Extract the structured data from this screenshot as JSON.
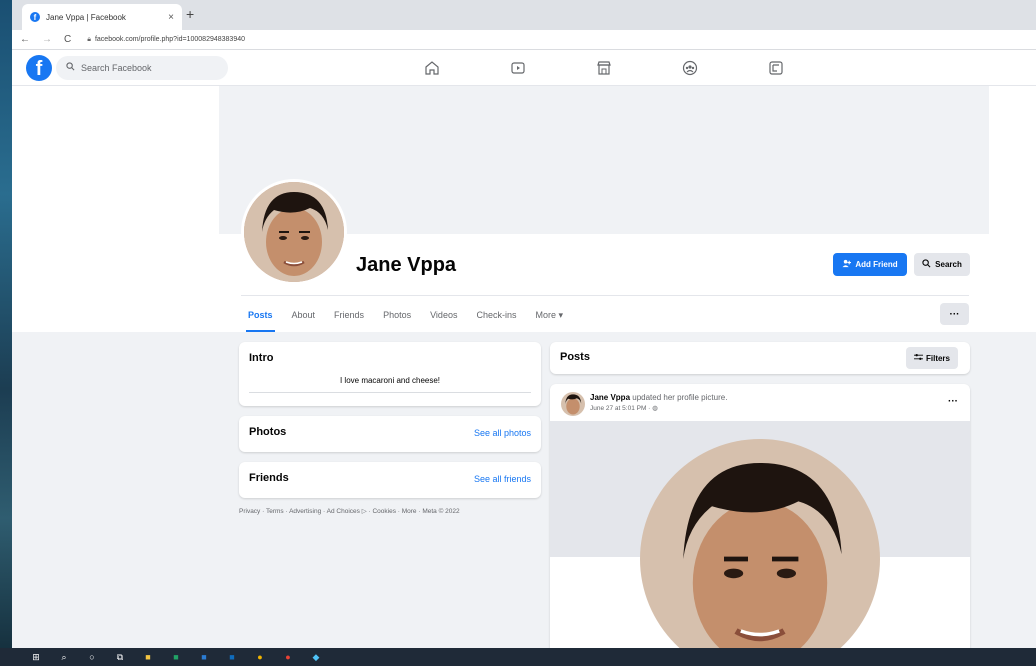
{
  "browser": {
    "tab_title": "Jane Vppa | Facebook",
    "tab_close": "×",
    "new_tab": "+",
    "url": "facebook.com/profile.php?id=100082948383940"
  },
  "fb": {
    "logo": "f",
    "search_placeholder": "Search Facebook"
  },
  "profile": {
    "name": "Jane Vppa",
    "add_friend_label": "Add Friend",
    "search_label": "Search",
    "more_dots": "···",
    "tabs": [
      "Posts",
      "About",
      "Friends",
      "Photos",
      "Videos",
      "Check-ins",
      "More ▾"
    ]
  },
  "intro": {
    "title": "Intro",
    "bio": "I love macaroni and cheese!"
  },
  "photos": {
    "title": "Photos",
    "see_all": "See all photos"
  },
  "friends": {
    "title": "Friends",
    "see_all": "See all friends"
  },
  "footer": "Privacy · Terms · Advertising · Ad Choices ▷ · Cookies · More · Meta © 2022",
  "posts": {
    "title": "Posts",
    "filters_label": "Filters",
    "post": {
      "author": "Jane Vppa",
      "action": " updated her profile picture.",
      "time": "June 27 at 5:01 PM · ",
      "dots": "···"
    }
  },
  "colors": {
    "fb_blue": "#1877f2",
    "bg": "#f0f2f5"
  }
}
